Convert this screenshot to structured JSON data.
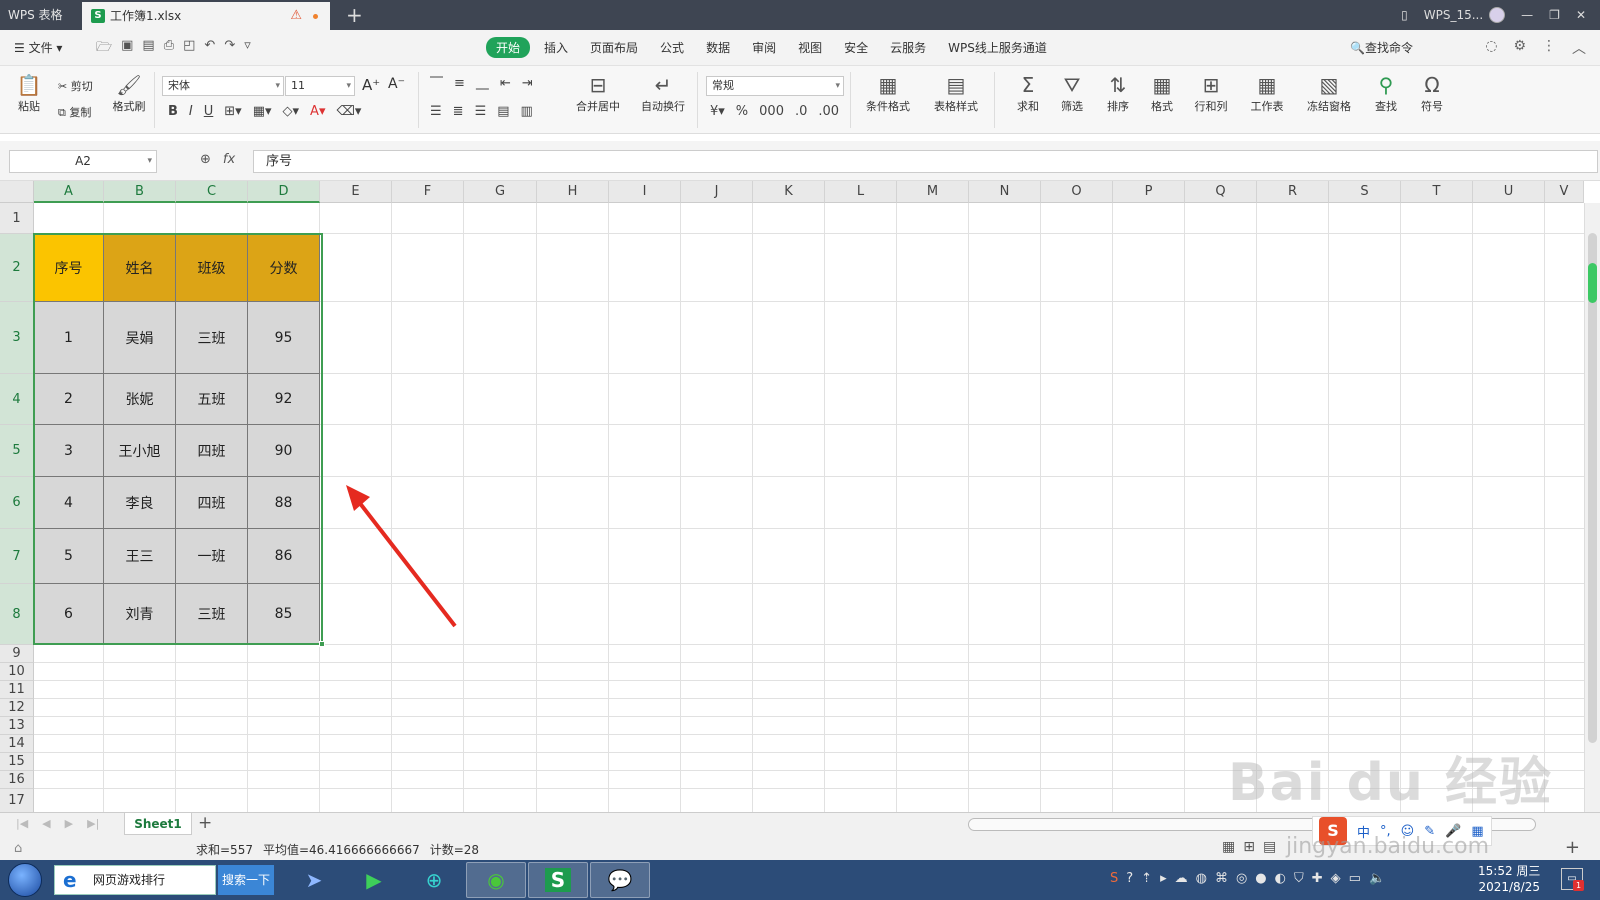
{
  "titlebar": {
    "app_name": "WPS 表格",
    "doc_tab": "工作簿1.xlsx",
    "user": "WPS_15..."
  },
  "menu": {
    "file": "文件",
    "tabs": [
      "开始",
      "插入",
      "页面布局",
      "公式",
      "数据",
      "审阅",
      "视图",
      "安全",
      "云服务",
      "WPS线上服务通道"
    ],
    "active_tab": "开始",
    "find": "查找命令"
  },
  "toolbar": {
    "paste": "粘贴",
    "cut": "剪切",
    "copy": "复制",
    "format_painter": "格式刷",
    "font": "宋体",
    "font_size": "11",
    "merge_center": "合并居中",
    "wrap": "自动换行",
    "number_format": "常规",
    "cond_format": "条件格式",
    "table_style": "表格样式",
    "sum": "求和",
    "filter": "筛选",
    "sort": "排序",
    "format": "格式",
    "row_col": "行和列",
    "worksheet": "工作表",
    "freeze": "冻结窗格",
    "find": "查找",
    "symbol": "符号"
  },
  "formula_bar": {
    "name_box": "A2",
    "fx": "fx",
    "content": "序号"
  },
  "columns": [
    "A",
    "B",
    "C",
    "D",
    "E",
    "F",
    "G",
    "H",
    "I",
    "J",
    "K",
    "L",
    "M",
    "N",
    "O",
    "P",
    "Q",
    "R",
    "S",
    "T",
    "U",
    "V"
  ],
  "rows": [
    "1",
    "2",
    "3",
    "4",
    "5",
    "6",
    "7",
    "8",
    "9",
    "10",
    "11",
    "12",
    "13",
    "14",
    "15",
    "16",
    "17"
  ],
  "table": {
    "headers": [
      "序号",
      "姓名",
      "班级",
      "分数"
    ],
    "rows": [
      [
        "1",
        "吴娟",
        "三班",
        "95"
      ],
      [
        "2",
        "张妮",
        "五班",
        "92"
      ],
      [
        "3",
        "王小旭",
        "四班",
        "90"
      ],
      [
        "4",
        "李良",
        "四班",
        "88"
      ],
      [
        "5",
        "王三",
        "一班",
        "86"
      ],
      [
        "6",
        "刘青",
        "三班",
        "85"
      ]
    ]
  },
  "sheet": {
    "name": "Sheet1"
  },
  "status": {
    "sum": "求和=557",
    "average": "平均值=46.416666666667",
    "count": "计数=28"
  },
  "taskbar": {
    "search_text": "网页游戏排行",
    "search_button": "搜索一下",
    "time": "15:52 周三",
    "date": "2021/8/25"
  },
  "watermark": {
    "text": "Bai du 经验",
    "sub": "jingyan.baidu.com"
  },
  "colors": {
    "accent": "#20a35a",
    "header_fill": "#dca416",
    "header_first": "#fbc400",
    "body_fill": "#d7d7d7",
    "selection": "#3f9d52",
    "arrow": "#e52a20"
  }
}
